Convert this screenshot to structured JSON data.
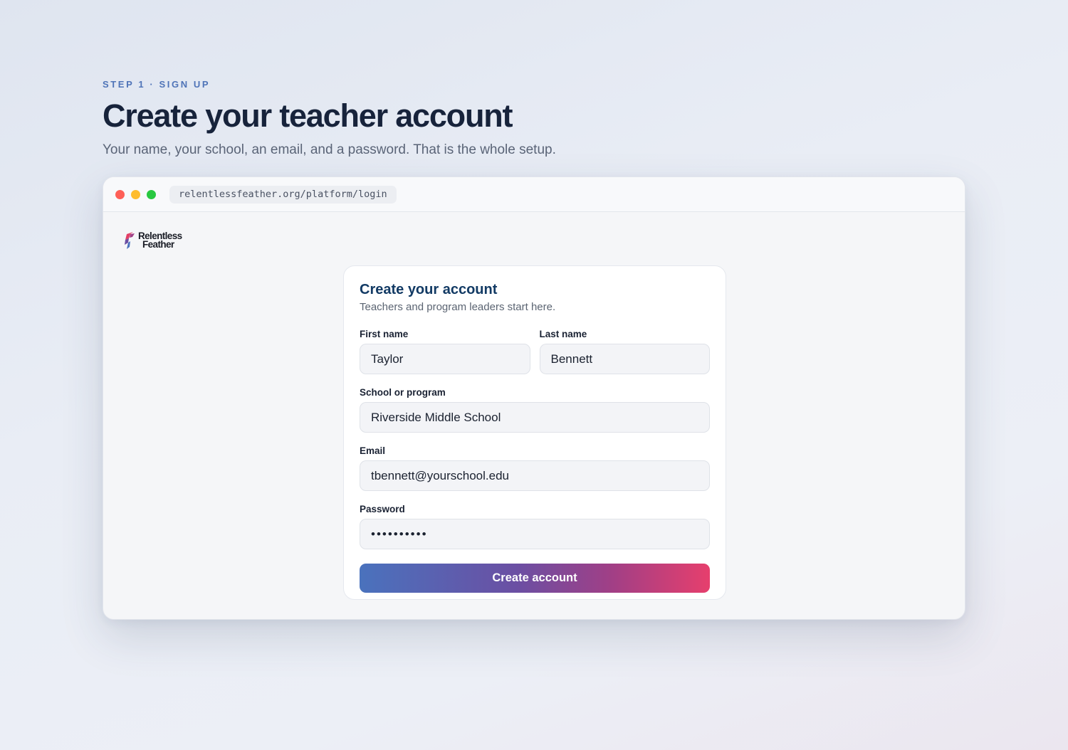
{
  "hero": {
    "eyebrow": "STEP 1 · SIGN UP",
    "headline": "Create your teacher account",
    "subline": "Your name, your school, an email, and a password. That is the whole setup."
  },
  "browser": {
    "url": "relentlessfeather.org/platform/login",
    "controls": [
      "close",
      "minimize",
      "maximize"
    ]
  },
  "logo": {
    "line1": "Relentless",
    "line2": "Feather",
    "icon": "feather-logo-icon"
  },
  "form": {
    "title": "Create your account",
    "subtitle": "Teachers and program leaders start here.",
    "first_name": {
      "label": "First name",
      "value": "Taylor"
    },
    "last_name": {
      "label": "Last name",
      "value": "Bennett"
    },
    "school": {
      "label": "School or program",
      "value": "Riverside Middle School"
    },
    "email": {
      "label": "Email",
      "value": "tbennett@yourschool.edu"
    },
    "password": {
      "label": "Password",
      "value": "••••••••••"
    },
    "submit_label": "Create account"
  },
  "colors": {
    "accent_blue": "#4a72bd",
    "accent_pink": "#e63f6d",
    "title_navy": "#123a64",
    "eyebrow_blue": "#4f74b8"
  }
}
